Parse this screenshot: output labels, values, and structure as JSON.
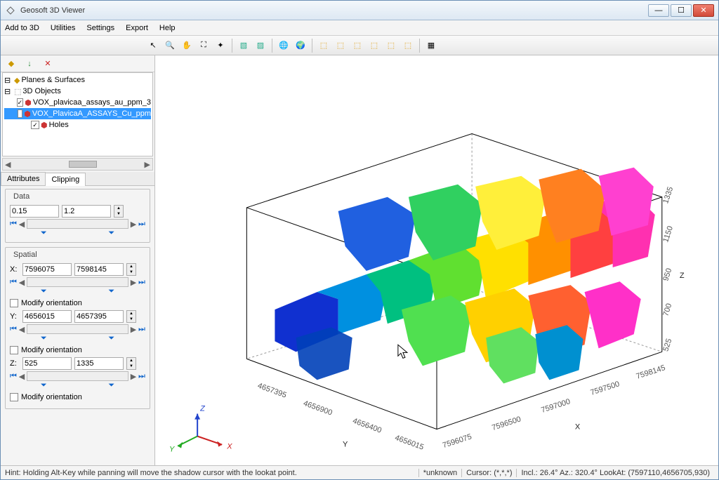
{
  "window": {
    "title": "Geosoft 3D Viewer"
  },
  "winbtns": {
    "min": "—",
    "max": "☐",
    "close": "✕"
  },
  "menu": {
    "addTo3D": "Add to 3D",
    "utilities": "Utilities",
    "settings": "Settings",
    "export": "Export",
    "help": "Help"
  },
  "sideTools": {
    "add": "◆",
    "down": "↓",
    "del": "✕"
  },
  "tree": {
    "planes": "Planes & Surfaces",
    "objects": "3D Objects",
    "items": [
      {
        "checked": true,
        "label": "VOX_plavicaa_assays_au_ppm_3"
      },
      {
        "checked": false,
        "label": "VOX_PlavicaA_ASSAYS_Cu_ppm",
        "selected": true
      },
      {
        "checked": true,
        "label": "Holes"
      }
    ]
  },
  "tabs": {
    "attributes": "Attributes",
    "clipping": "Clipping"
  },
  "clipping": {
    "dataLabel": "Data",
    "dataMin": "0.15",
    "dataMax": "1.2",
    "spatialLabel": "Spatial",
    "xLabel": "X:",
    "xMin": "7596075",
    "xMax": "7598145",
    "modifyOrientation": "Modify orientation",
    "yLabel": "Y:",
    "yMin": "4656015",
    "yMax": "4657395",
    "zLabel": "Z:",
    "zMin": "525",
    "zMax": "1335"
  },
  "axes": {
    "xLabel": "X",
    "yLabel": "Y",
    "zLabel": "Z",
    "xTicks": [
      "7596075",
      "7596500",
      "7597000",
      "7597500",
      "7598145"
    ],
    "yTicks": [
      "4656015",
      "4656400",
      "4656900",
      "4657395"
    ],
    "zTicks": [
      "525",
      "700",
      "950",
      "1150",
      "1335"
    ]
  },
  "legend": {
    "x": "X",
    "y": "Y",
    "z": "Z"
  },
  "status": {
    "hint": "Hint: Holding Alt-Key while panning will move the shadow cursor with the lookat point.",
    "unknown": "*unknown",
    "cursor": "Cursor: (*,*,*)",
    "incl": "Incl.: 26.4° Az.: 320.4° LookAt: (7597110,4656705,930)"
  },
  "icons": {
    "cursor": "↖",
    "zoom": "🔍",
    "pan": "✋",
    "fit": "⛶",
    "center": "✦",
    "layer1": "▧",
    "layer2": "▨",
    "globe": "🌐",
    "world": "🌍",
    "cube1": "⬚",
    "cube2": "⬚",
    "cube3": "⬚",
    "cube4": "⬚",
    "cube5": "⬚",
    "cube6": "⬚",
    "extra": "▦"
  }
}
